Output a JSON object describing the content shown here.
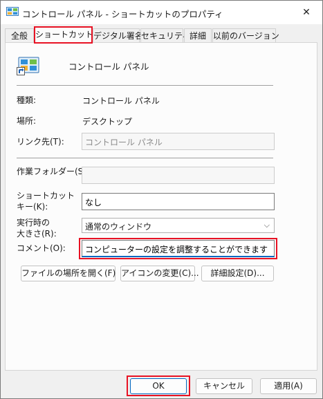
{
  "window": {
    "title": "コントロール パネル - ショートカットのプロパティ",
    "close_glyph": "✕"
  },
  "tabs": [
    {
      "label": "全般"
    },
    {
      "label": "ショートカット"
    },
    {
      "label": "デジタル署名"
    },
    {
      "label": "セキュリティ"
    },
    {
      "label": "詳細"
    },
    {
      "label": "以前のバージョン"
    }
  ],
  "shortcut": {
    "name": "コントロール パネル",
    "type_label": "種類:",
    "type_value": "コントロール パネル",
    "location_label": "場所:",
    "location_value": "デスクトップ",
    "target_label": "リンク先(T):",
    "target_value": "コントロール パネル",
    "workdir_label": "作業フォルダー(S):",
    "workdir_value": "",
    "hotkey_label_1": "ショートカット",
    "hotkey_label_2": "キー(K):",
    "hotkey_value": "なし",
    "run_label_1": "実行時の",
    "run_label_2": "大きさ(R):",
    "run_value": "通常のウィンドウ",
    "comment_label": "コメント(O):",
    "comment_value": "コンピューターの設定を調整することができます"
  },
  "buttons": {
    "open_location": "ファイルの場所を開く(F)",
    "change_icon": "アイコンの変更(C)...",
    "advanced": "詳細設定(D)..."
  },
  "footer": {
    "ok": "OK",
    "cancel": "キャンセル",
    "apply": "適用(A)"
  },
  "colors": {
    "highlight": "#e81123",
    "accent": "#0067c0"
  }
}
